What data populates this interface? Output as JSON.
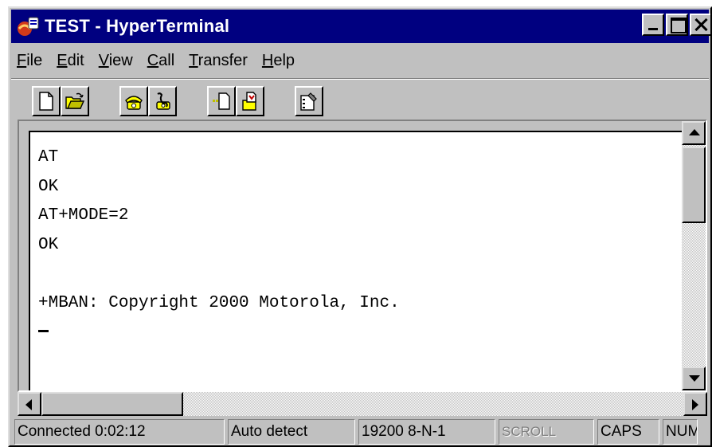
{
  "window": {
    "title": "TEST - HyperTerminal",
    "title_bar_color": "#000080",
    "face_color": "#c0c0c0",
    "caption_buttons": [
      "minimize-icon",
      "maximize-icon",
      "close-icon"
    ]
  },
  "menu": {
    "items": [
      {
        "label": "File",
        "mnemonic": "F"
      },
      {
        "label": "Edit",
        "mnemonic": "E"
      },
      {
        "label": "View",
        "mnemonic": "V"
      },
      {
        "label": "Call",
        "mnemonic": "C"
      },
      {
        "label": "Transfer",
        "mnemonic": "T"
      },
      {
        "label": "Help",
        "mnemonic": "H"
      }
    ]
  },
  "toolbar": {
    "groups": [
      [
        "new-document-icon",
        "open-folder-icon"
      ],
      [
        "connect-phone-icon",
        "disconnect-phone-icon"
      ],
      [
        "send-file-icon",
        "receive-file-icon"
      ],
      [
        "properties-icon"
      ]
    ]
  },
  "terminal": {
    "lines": [
      "AT",
      "OK",
      "AT+MODE=2",
      "OK",
      "",
      "+MBAN: Copyright 2000 Motorola, Inc."
    ],
    "cursor": "_"
  },
  "status_bar": {
    "connected": "Connected 0:02:12",
    "detect": "Auto detect",
    "port_settings": "19200 8-N-1",
    "scroll": "SCROLL",
    "caps": "CAPS",
    "num": "NUM"
  }
}
